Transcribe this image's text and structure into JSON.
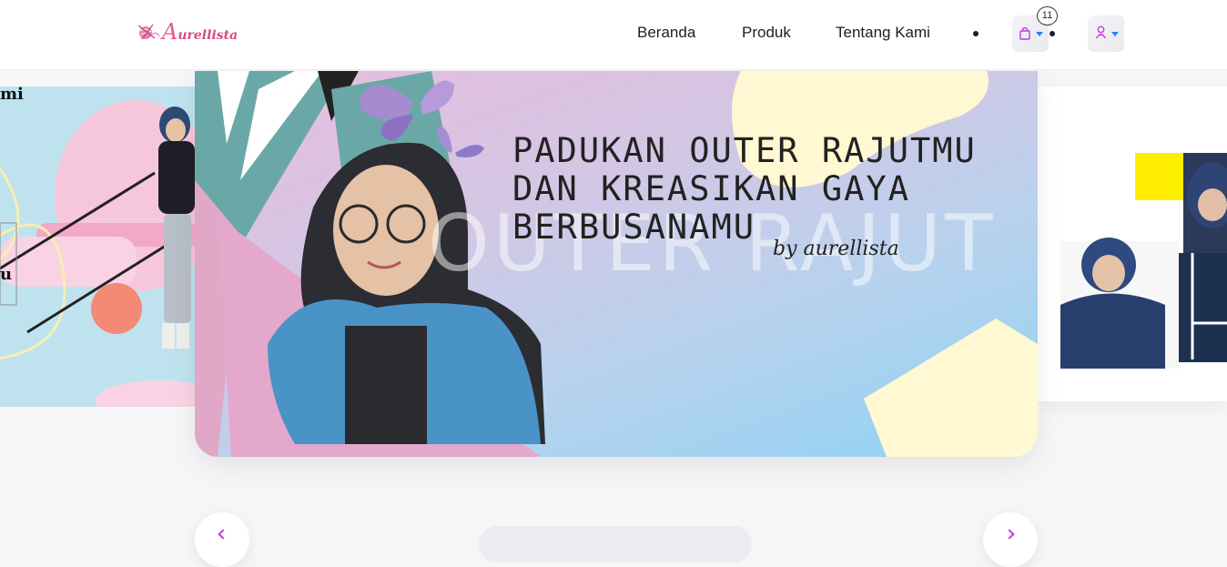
{
  "brand": {
    "logo_text": "urellista",
    "logo_initial": "A"
  },
  "nav": {
    "items": [
      {
        "label": "Beranda"
      },
      {
        "label": "Produk"
      },
      {
        "label": "Tentang Kami"
      }
    ],
    "cart_count": "11",
    "icons": {
      "cart": "shopping-bag-icon",
      "user": "user-icon",
      "dropdown": "caret-down-icon"
    }
  },
  "hero": {
    "headline": "PADUKAN OUTER RAJUTMU DAN KREASIKAN GAYA BERBUSANAMU",
    "watermark": "OUTER RAJUT",
    "signature": "by aurellista"
  },
  "left_slide": {
    "caption_fragment": "mi",
    "side_fragment": "u"
  },
  "colors": {
    "accent_pink": "#d64b86",
    "icon_purple": "#c03bd6",
    "dropdown_blue": "#2d7ff0",
    "hero_pink": "#e9bcdd",
    "hero_blue": "#8fd2f3",
    "teal": "#6aa8a8",
    "cream": "#fff8d2"
  }
}
